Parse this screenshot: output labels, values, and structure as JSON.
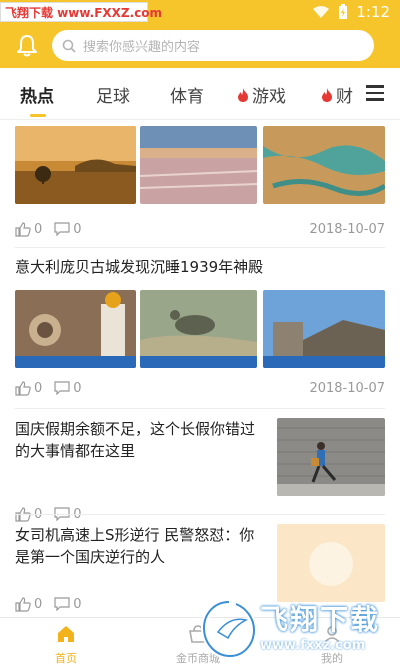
{
  "status_bar": {
    "watermark_text": "飞翔下载 www.FXXZ.com",
    "time": "1:12"
  },
  "search": {
    "placeholder": "搜索你感兴趣的内容"
  },
  "tabs": [
    {
      "label": "热点"
    },
    {
      "label": "足球"
    },
    {
      "label": "体育"
    },
    {
      "label": "游戏"
    },
    {
      "label": "财"
    }
  ],
  "feed": [
    {
      "title": "",
      "likes": "0",
      "comments": "0",
      "date": "2018-10-07"
    },
    {
      "title": "意大利庞贝古城发现沉睡1939年神殿",
      "likes": "0",
      "comments": "0",
      "date": "2018-10-07"
    },
    {
      "title": "国庆假期余额不足，这个长假你错过的大事情都在这里",
      "likes": "0",
      "comments": "0"
    },
    {
      "title": "女司机高速上S形逆行 民警怒怼：你是第一个国庆逆行的人",
      "likes": "0",
      "comments": "0"
    }
  ],
  "bottom_nav": [
    {
      "label": "首页"
    },
    {
      "label": "金币商城"
    },
    {
      "label": "我的"
    }
  ],
  "watermark": {
    "brand": "飞翔下载",
    "url": "www.fxxz.com"
  },
  "colors": {
    "accent": "#f6c52b",
    "active_nav": "#f2b21c",
    "hot_icon": "#e53935"
  }
}
